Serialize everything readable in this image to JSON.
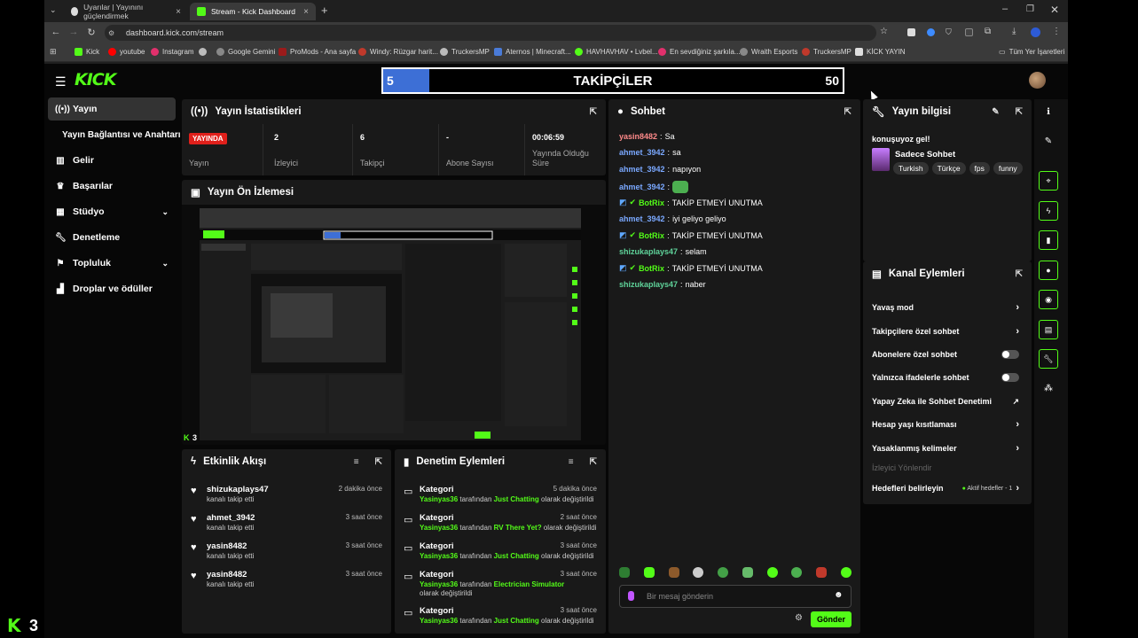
{
  "browser": {
    "tabs": [
      {
        "label": "Uyarılar | Yayınını güçlendirmek"
      },
      {
        "label": "Stream - Kick Dashboard"
      }
    ],
    "url": "dashboard.kick.com/stream",
    "bookmarks": [
      "Kick",
      "youtube",
      "Instagram",
      "",
      "Google Gemini",
      "ProMods - Ana sayfa",
      "Windy: Rüzgar harit...",
      "TruckersMP",
      "Aternos | Minecraft...",
      "HAVHAVHAV • Lvbel...",
      "En sevdiğiniz şarkıla...",
      "Wraith Esports",
      "TruckersMP",
      "KİCK YAYIN"
    ],
    "bookmarks_right": "Tüm Yer İşaretleri"
  },
  "app": {
    "logo": "KICK",
    "goal": {
      "current": "5",
      "title": "TAKİPÇİLER",
      "max": "50",
      "progress": 0.1
    }
  },
  "sidebar": {
    "items": [
      {
        "label": "Yayın",
        "icon": "broadcast-icon"
      },
      {
        "label": "Yayın Bağlantısı ve Anahtarı",
        "icon": ""
      },
      {
        "label": "Gelir",
        "icon": "chart-icon"
      },
      {
        "label": "Başarılar",
        "icon": "trophy-icon"
      },
      {
        "label": "Stüdyo",
        "icon": "grid-icon"
      },
      {
        "label": "Denetleme",
        "icon": "wrench-icon"
      },
      {
        "label": "Topluluk",
        "icon": "community-icon"
      },
      {
        "label": "Droplar ve ödüller",
        "icon": "gift-icon"
      }
    ]
  },
  "stats": {
    "title": "Yayın İstatistikleri",
    "items": [
      {
        "value": "YAYINDA",
        "label": "Yayın"
      },
      {
        "value": "2",
        "label": "İzleyici"
      },
      {
        "value": "6",
        "label": "Takipçi"
      },
      {
        "value": "-",
        "label": "Abone Sayısı"
      },
      {
        "value": "00:06:59",
        "label": "Yayında Olduğu Süre"
      }
    ]
  },
  "preview": {
    "title": "Yayın Ön İzlemesi",
    "badge": "3"
  },
  "activity": {
    "title": "Etkinlik Akışı",
    "items": [
      {
        "name": "shizukaplays47",
        "action": "kanalı takip etti",
        "time": "2 dakika önce"
      },
      {
        "name": "ahmet_3942",
        "action": "kanalı takip etti",
        "time": "3 saat önce"
      },
      {
        "name": "yasin8482",
        "action": "kanalı takip etti",
        "time": "3 saat önce"
      },
      {
        "name": "yasin8482",
        "action": "kanalı takip etti",
        "time": "3 saat önce"
      }
    ]
  },
  "moderation": {
    "title": "Denetim Eylemleri",
    "items": [
      {
        "type": "Kategori",
        "user": "Yasinyas36",
        "mid": "tarafından",
        "category": "Just Chatting",
        "end": "olarak değiştirildi",
        "time": "5 dakika önce"
      },
      {
        "type": "Kategori",
        "user": "Yasinyas36",
        "mid": "tarafından",
        "category": "RV There Yet?",
        "end": "olarak değiştirildi",
        "time": "2 saat önce"
      },
      {
        "type": "Kategori",
        "user": "Yasinyas36",
        "mid": "tarafından",
        "category": "Just Chatting",
        "end": "olarak değiştirildi",
        "time": "3 saat önce"
      },
      {
        "type": "Kategori",
        "user": "Yasinyas36",
        "mid": "tarafından",
        "category": "Electrician Simulator",
        "end": "olarak değiştirildi",
        "time": "3 saat önce"
      },
      {
        "type": "Kategori",
        "user": "Yasinyas36",
        "mid": "tarafından",
        "category": "Just Chatting",
        "end": "olarak değiştirildi",
        "time": "3 saat önce"
      }
    ]
  },
  "chat": {
    "title": "Sohbet",
    "messages": [
      {
        "user": "yasin8482",
        "text": "Sa",
        "color": "#ff8a8a"
      },
      {
        "user": "ahmet_3942",
        "text": "sa",
        "color": "#7aa8ff"
      },
      {
        "user": "ahmet_3942",
        "text": "napıyon",
        "color": "#7aa8ff"
      },
      {
        "user": "ahmet_3942",
        "text": "",
        "color": "#7aa8ff",
        "emote": true
      },
      {
        "user": "BotRix",
        "text": "TAKİP ETMEYİ UNUTMA",
        "color": "#53fc18",
        "bot": true
      },
      {
        "user": "ahmet_3942",
        "text": "iyi geliyo geliyo",
        "color": "#7aa8ff"
      },
      {
        "user": "BotRix",
        "text": "TAKİP ETMEYİ UNUTMA",
        "color": "#53fc18",
        "bot": true
      },
      {
        "user": "shizukaplays47",
        "text": "selam",
        "color": "#5fd39a"
      },
      {
        "user": "BotRix",
        "text": "TAKİP ETMEYİ UNUTMA",
        "color": "#53fc18",
        "bot": true
      },
      {
        "user": "shizukaplays47",
        "text": "naber",
        "color": "#5fd39a"
      }
    ],
    "placeholder": "Bir mesaj gönderin",
    "send": "Gönder"
  },
  "streaminfo": {
    "title": "Yayın bilgisi",
    "stream_title": "konuşuyoz gel!",
    "category": "Sadece Sohbet",
    "tags": [
      "Turkish",
      "Türkçe",
      "fps",
      "funny"
    ]
  },
  "channel_actions": {
    "title": "Kanal Eylemleri",
    "items": [
      {
        "label": "Yavaş mod",
        "control": "chevron"
      },
      {
        "label": "Takipçilere özel sohbet",
        "control": "chevron"
      },
      {
        "label": "Abonelere özel sohbet",
        "control": "toggle"
      },
      {
        "label": "Yalnızca ifadelerle sohbet",
        "control": "toggle"
      },
      {
        "label": "Yapay Zeka ile Sohbet Denetimi",
        "control": "external"
      },
      {
        "label": "Hesap yaşı kısıtlaması",
        "control": "chevron"
      },
      {
        "label": "Yasaklanmış kelimeler",
        "control": "chevron"
      },
      {
        "label": "İzleyici Yönlendir",
        "control": "disabled"
      },
      {
        "label": "Hedefleri belirleyin",
        "control": "chevron",
        "status": "Aktif hedefler - 1"
      }
    ]
  },
  "overlay": {
    "badge": "3"
  }
}
